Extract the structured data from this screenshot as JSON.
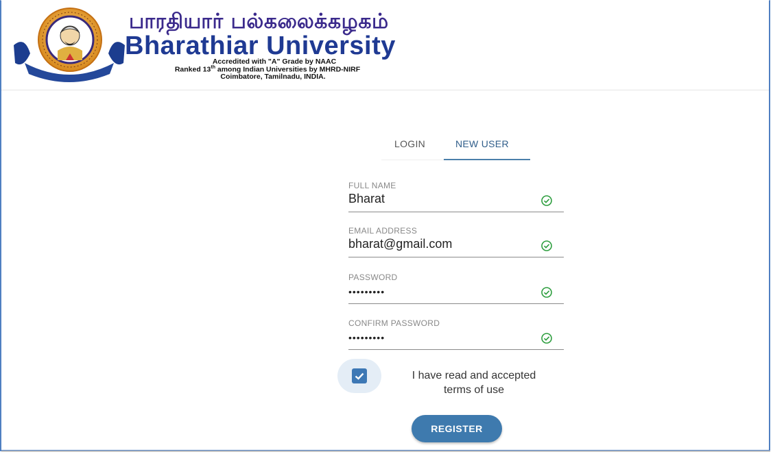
{
  "header": {
    "tamil_title": "பாரதியார் பல்கலைக்கழகம்",
    "university_name": "Bharathiar University",
    "accreditation": "Accredited with \"A\" Grade by NAAC",
    "ranking_prefix": "Ranked 13",
    "ranking_sup": "th",
    "ranking_suffix": " among Indian Universities by MHRD-NIRF",
    "location": "Coimbatore, Tamilnadu, INDIA.",
    "logo_icon": "university-seal-icon"
  },
  "tabs": {
    "login": "LOGIN",
    "new_user": "NEW USER",
    "active": "NEW USER"
  },
  "form": {
    "full_name": {
      "label": "FULL NAME",
      "value": "Bharat"
    },
    "email": {
      "label": "EMAIL ADDRESS",
      "value": "bharat@gmail.com"
    },
    "password": {
      "label": "PASSWORD",
      "value": "•••••••••"
    },
    "confirm_password": {
      "label": "CONFIRM PASSWORD",
      "value": "•••••••••"
    },
    "terms_line1": "I have read and accepted",
    "terms_line2": "terms of use",
    "terms_checked": true,
    "register_label": "REGISTER"
  },
  "colors": {
    "accent": "#3e7aae",
    "valid_check": "#2e9e3f",
    "frame_border": "#4f7fc1"
  }
}
